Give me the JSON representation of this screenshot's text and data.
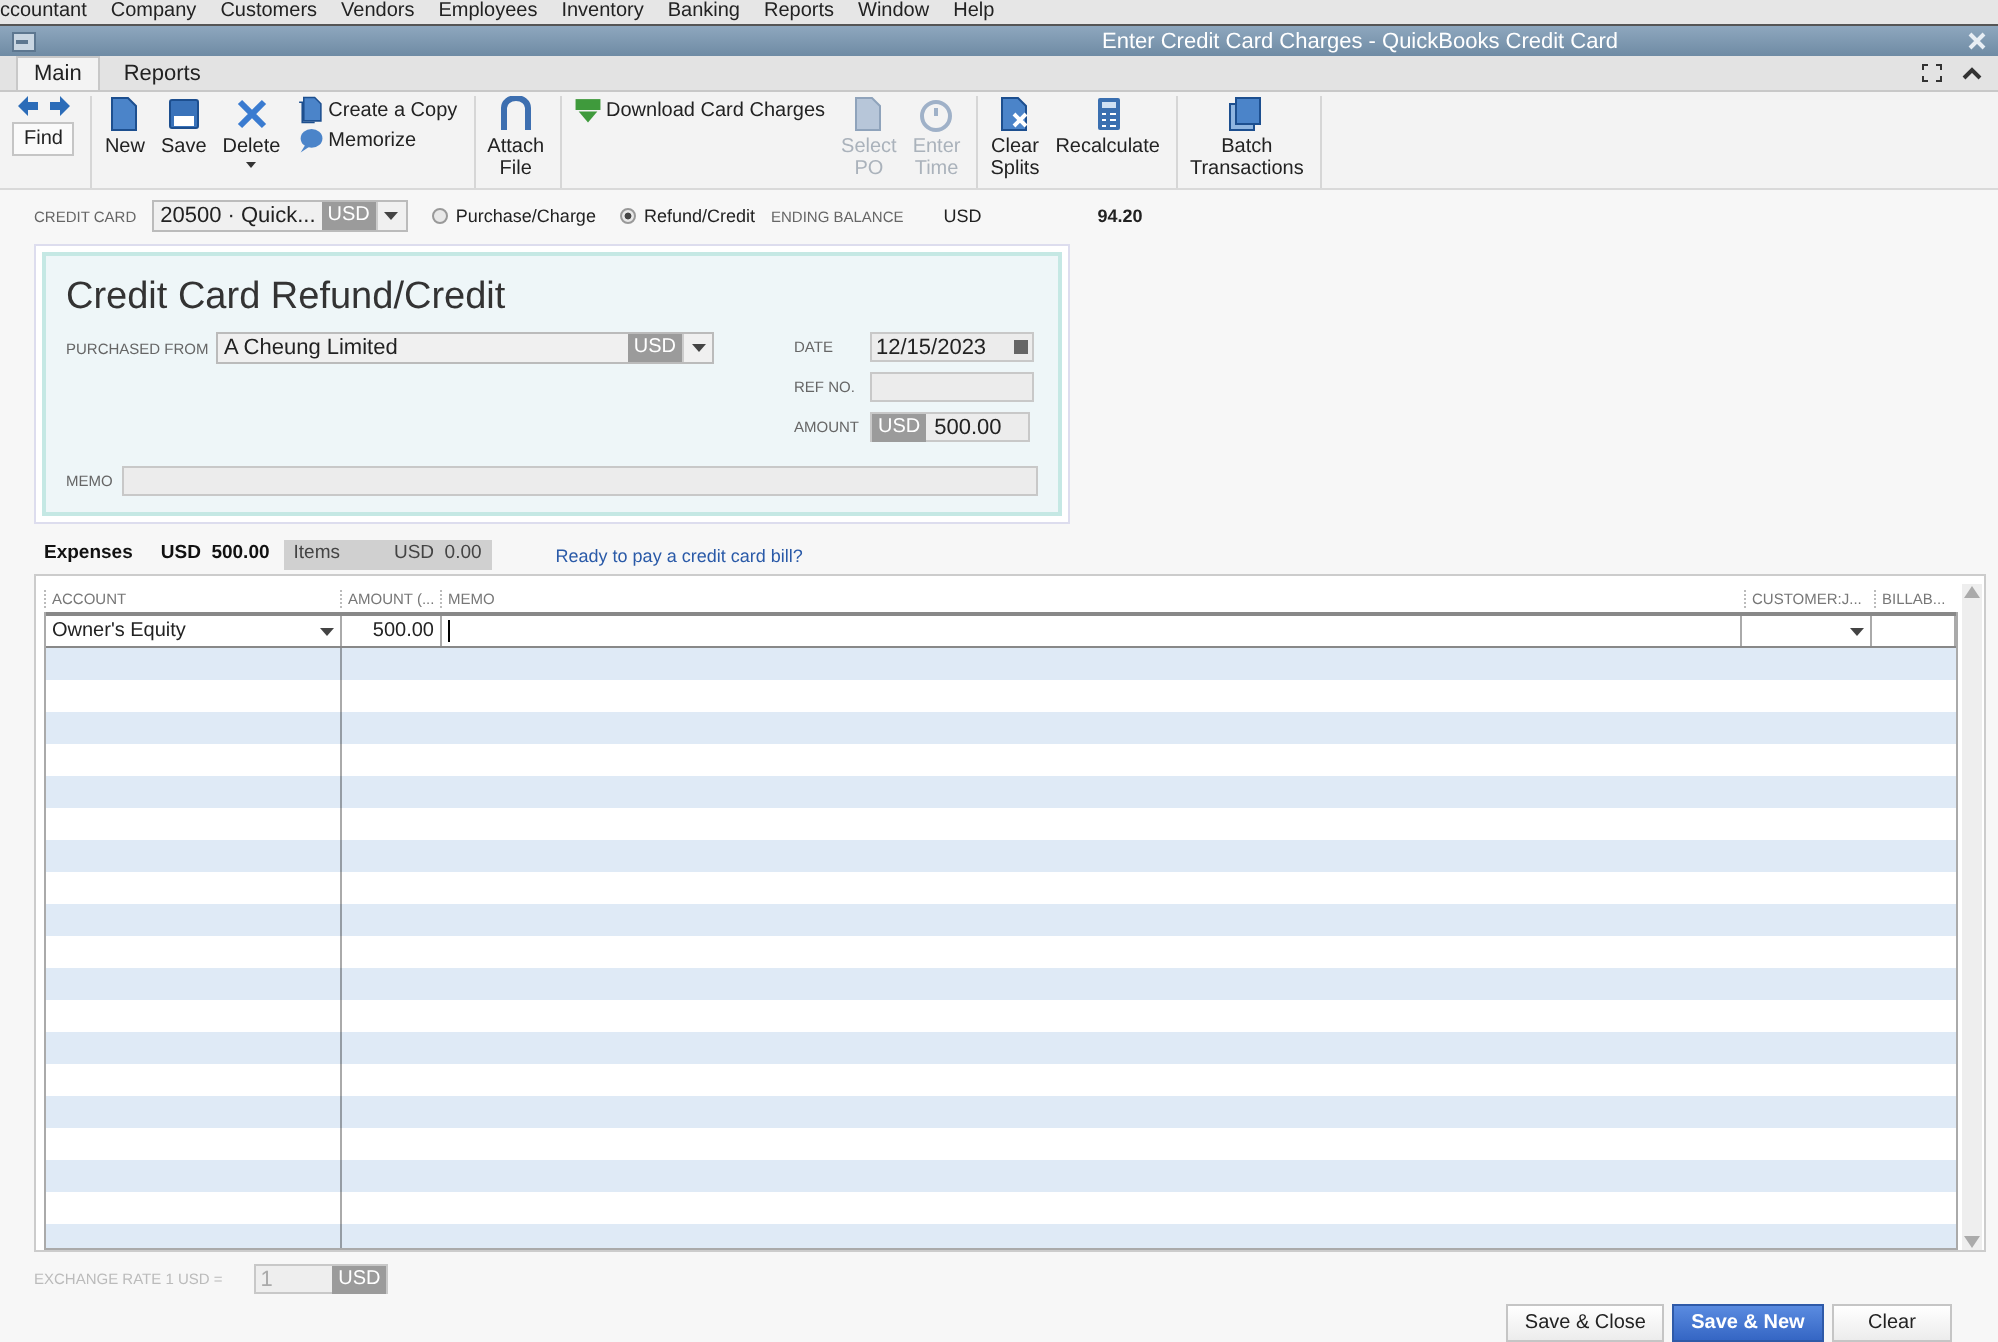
{
  "menu_bar": [
    "ccountant",
    "Company",
    "Customers",
    "Vendors",
    "Employees",
    "Inventory",
    "Banking",
    "Reports",
    "Window",
    "Help"
  ],
  "window": {
    "title": "Enter Credit Card Charges - QuickBooks Credit Card"
  },
  "tabs": [
    {
      "label": "Main",
      "selected": true
    },
    {
      "label": "Reports",
      "selected": false
    }
  ],
  "toolbar": {
    "find": "Find",
    "groups": [
      [
        {
          "kind": "large",
          "label": "New",
          "disabled": false
        },
        {
          "kind": "large",
          "label": "Save",
          "disabled": false
        },
        {
          "kind": "dropdown",
          "label": "Delete",
          "disabled": false
        },
        {
          "kind": "stack",
          "items": [
            {
              "label": "Create a Copy",
              "disabled": false
            },
            {
              "label": "Memorize",
              "disabled": false
            }
          ]
        }
      ],
      [
        {
          "kind": "large",
          "label": "Attach File",
          "disabled": false
        }
      ],
      [
        {
          "kind": "stack",
          "items": [
            {
              "label": "Download Card Charges",
              "disabled": false
            }
          ]
        },
        {
          "kind": "large",
          "label": "Select PO",
          "disabled": true
        },
        {
          "kind": "large",
          "label": "Enter Time",
          "disabled": true
        }
      ],
      [
        {
          "kind": "large",
          "label": "Clear Splits",
          "disabled": false
        },
        {
          "kind": "large",
          "label": "Recalculate",
          "disabled": false
        }
      ],
      [
        {
          "kind": "large",
          "label": "Batch Transactions",
          "disabled": false
        }
      ]
    ]
  },
  "header": {
    "credit_card_label": "CREDIT CARD",
    "credit_card": "20500 · Quick...",
    "credit_card_currency": "USD",
    "modes": [
      {
        "label": "Purchase/Charge",
        "selected": false
      },
      {
        "label": "Refund/Credit",
        "selected": true
      }
    ],
    "ending_balance_label": "ENDING BALANCE",
    "ending_balance_currency": "USD",
    "ending_balance": "94.20"
  },
  "form": {
    "title": "Credit Card Refund/Credit",
    "purchased_from_label": "PURCHASED FROM",
    "purchased_from": "A Cheung Limited",
    "purchased_from_currency": "USD",
    "date_label": "DATE",
    "date": "12/15/2023",
    "ref_no_label": "REF NO.",
    "amount_label": "AMOUNT",
    "amount_currency": "USD",
    "amount": "500.00",
    "memo_label": "MEMO"
  },
  "split_tabs": [
    {
      "label": "Expenses",
      "total": "USD  500.00",
      "selected": true
    },
    {
      "label": "Items",
      "total": "USD  0.00",
      "selected": false
    }
  ],
  "bill_link": "Ready to pay a credit card bill?",
  "table": {
    "columns": [
      "ACCOUNT",
      "AMOUNT (...",
      "MEMO",
      "CUSTOMER:J...",
      "BILLAB..."
    ],
    "rows": [
      {
        "account": "Owner's Equity",
        "amount": "500.00"
      }
    ]
  },
  "exchange_rate": {
    "label": "EXCHANGE RATE 1 USD =",
    "value": "1",
    "currency": "USD"
  },
  "buttons": [
    {
      "label": "Save & Close",
      "primary": false
    },
    {
      "label": "Save & New",
      "primary": true
    },
    {
      "label": "Clear",
      "primary": false
    }
  ]
}
